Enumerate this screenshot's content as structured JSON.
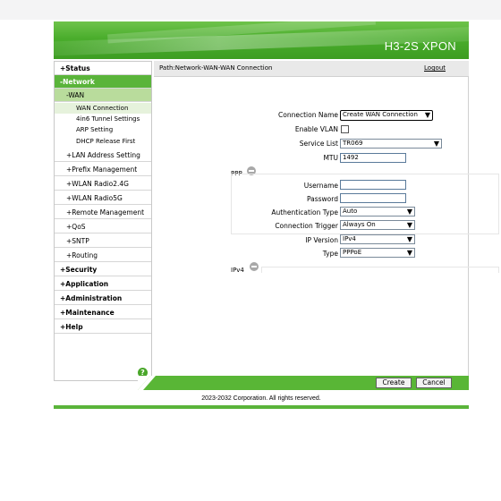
{
  "brand": "H3-2S XPON",
  "path": "Path:Network-WAN-WAN Connection",
  "logout": "Logout",
  "nav": {
    "status": "+Status",
    "network": "-Network",
    "wan": "-WAN",
    "wan_connection": "WAN Connection",
    "tunnel": "4in6 Tunnel Settings",
    "arp": "ARP Setting",
    "dhcp_release": "DHCP Release First",
    "lan": "+LAN Address Setting",
    "prefix": "+Prefix Management",
    "wlan24": "+WLAN Radio2.4G",
    "wlan5": "+WLAN Radio5G",
    "remote": "+Remote Management",
    "qos": "+QoS",
    "sntp": "+SNTP",
    "routing": "+Routing",
    "security": "+Security",
    "application": "+Application",
    "administration": "+Administration",
    "maintenance": "+Maintenance",
    "help": "+Help",
    "help_badge": "?"
  },
  "form": {
    "connection_name_label": "Connection Name",
    "connection_name_value": "Create WAN Connection",
    "enable_vlan_label": "Enable VLAN",
    "service_list_label": "Service List",
    "service_list_value": "TR069",
    "mtu_label": "MTU",
    "mtu_value": "1492",
    "ppp_section": "PPP",
    "username_label": "Username",
    "username_value": "",
    "password_label": "Password",
    "password_value": "",
    "auth_type_label": "Authentication Type",
    "auth_type_value": "Auto",
    "conn_trigger_label": "Connection Trigger",
    "conn_trigger_value": "Always On",
    "ip_version_label": "IP Version",
    "ip_version_value": "IPv4",
    "type_label": "Type",
    "type_value": "PPPoE",
    "ipv4_section": "IPv4"
  },
  "buttons": {
    "create": "Create",
    "cancel": "Cancel"
  },
  "copyright": "2023-2032 Corporation. All rights reserved.",
  "colors": {
    "accent_green": "#5ab43a",
    "wan_highlight": "#b9dc9c"
  }
}
